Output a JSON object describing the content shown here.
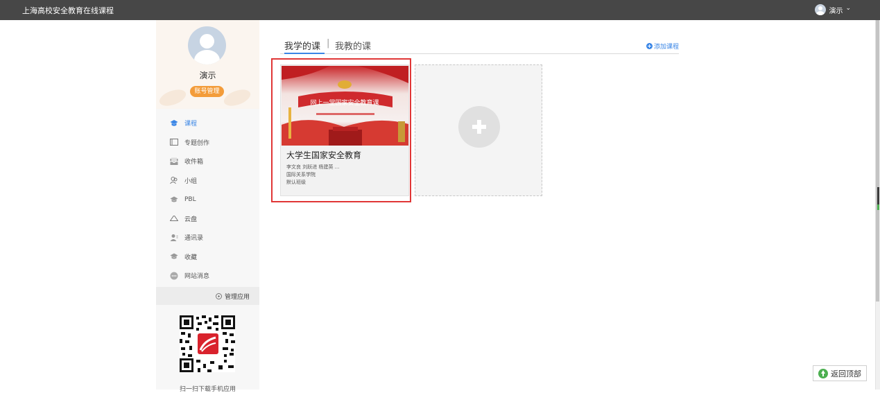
{
  "header": {
    "site_title": "上海高校安全教育在线课程",
    "user_name": "演示",
    "user_menu_caret": "⌄"
  },
  "profile": {
    "name": "演示",
    "account_button": "账号管理"
  },
  "sidebar": {
    "items": [
      {
        "label": "课程",
        "icon": "course-icon",
        "active": true
      },
      {
        "label": "专题创作",
        "icon": "topic-icon",
        "active": false
      },
      {
        "label": "收件箱",
        "icon": "inbox-icon",
        "active": false
      },
      {
        "label": "小组",
        "icon": "group-icon",
        "active": false
      },
      {
        "label": "PBL",
        "icon": "pbl-icon",
        "active": false
      },
      {
        "label": "云盘",
        "icon": "cloud-icon",
        "active": false
      },
      {
        "label": "通讯录",
        "icon": "contacts-icon",
        "active": false
      },
      {
        "label": "收藏",
        "icon": "favorites-icon",
        "active": false
      },
      {
        "label": "网站消息",
        "icon": "message-icon",
        "active": false
      }
    ],
    "manage_apps": "管理应用",
    "qr_caption": "扫一扫下载手机应用"
  },
  "main": {
    "tabs": [
      {
        "label": "我学的课",
        "active": true
      },
      {
        "label": "我教的课",
        "active": false
      }
    ],
    "tab_separator": "|",
    "add_course": "添加课程",
    "course": {
      "title": "大学生国家安全教育",
      "teachers": "李文良 刘跃进 杨建英 ...",
      "department": "国际关系学院",
      "class": "默认班级",
      "cover_banner": "网上一堂国家安全教育课"
    }
  },
  "back_to_top": "返回顶部",
  "colors": {
    "topbar": "#474747",
    "accent": "#3a86e6",
    "account_button": "#f39c3a",
    "highlight_border": "#e03636",
    "back_top_icon": "#4caf50"
  }
}
